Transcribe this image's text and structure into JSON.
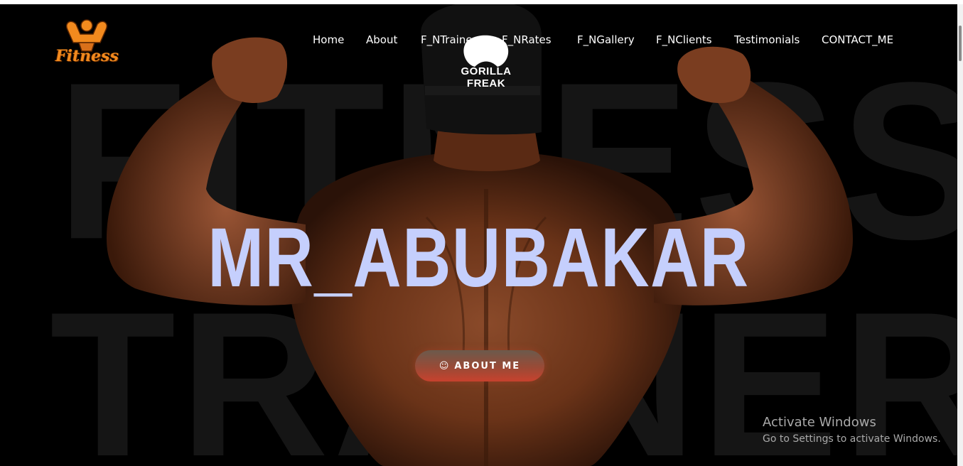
{
  "logo": {
    "text": "Fitness",
    "icon": "flexing-bodybuilder-icon"
  },
  "nav": {
    "items": [
      {
        "label": "Home"
      },
      {
        "label": "About"
      },
      {
        "label": "F_NTrainer"
      },
      {
        "label": "F_NRates"
      },
      {
        "label": "F_NGallery"
      },
      {
        "label": "F_NClients"
      },
      {
        "label": "Testimonials"
      },
      {
        "label": "CONTACT_ME"
      }
    ]
  },
  "background_words": {
    "line1": "FITNESS",
    "line2": "TRAINER"
  },
  "cap": {
    "text": "GORILLA FREAK",
    "icon": "gorilla-face-icon"
  },
  "hero": {
    "title": "MR_ABUBAKAR",
    "button_label": "ABOUT ME",
    "button_icon": "smile-icon"
  },
  "watermark": {
    "title": "Activate Windows",
    "subtitle": "Go to Settings to activate Windows."
  },
  "colors": {
    "title": "#c5cffd",
    "logo": "#f28a1e",
    "button_gradient_start": "#6c5a4c",
    "button_gradient_end": "#c8422e",
    "background": "#000000"
  }
}
